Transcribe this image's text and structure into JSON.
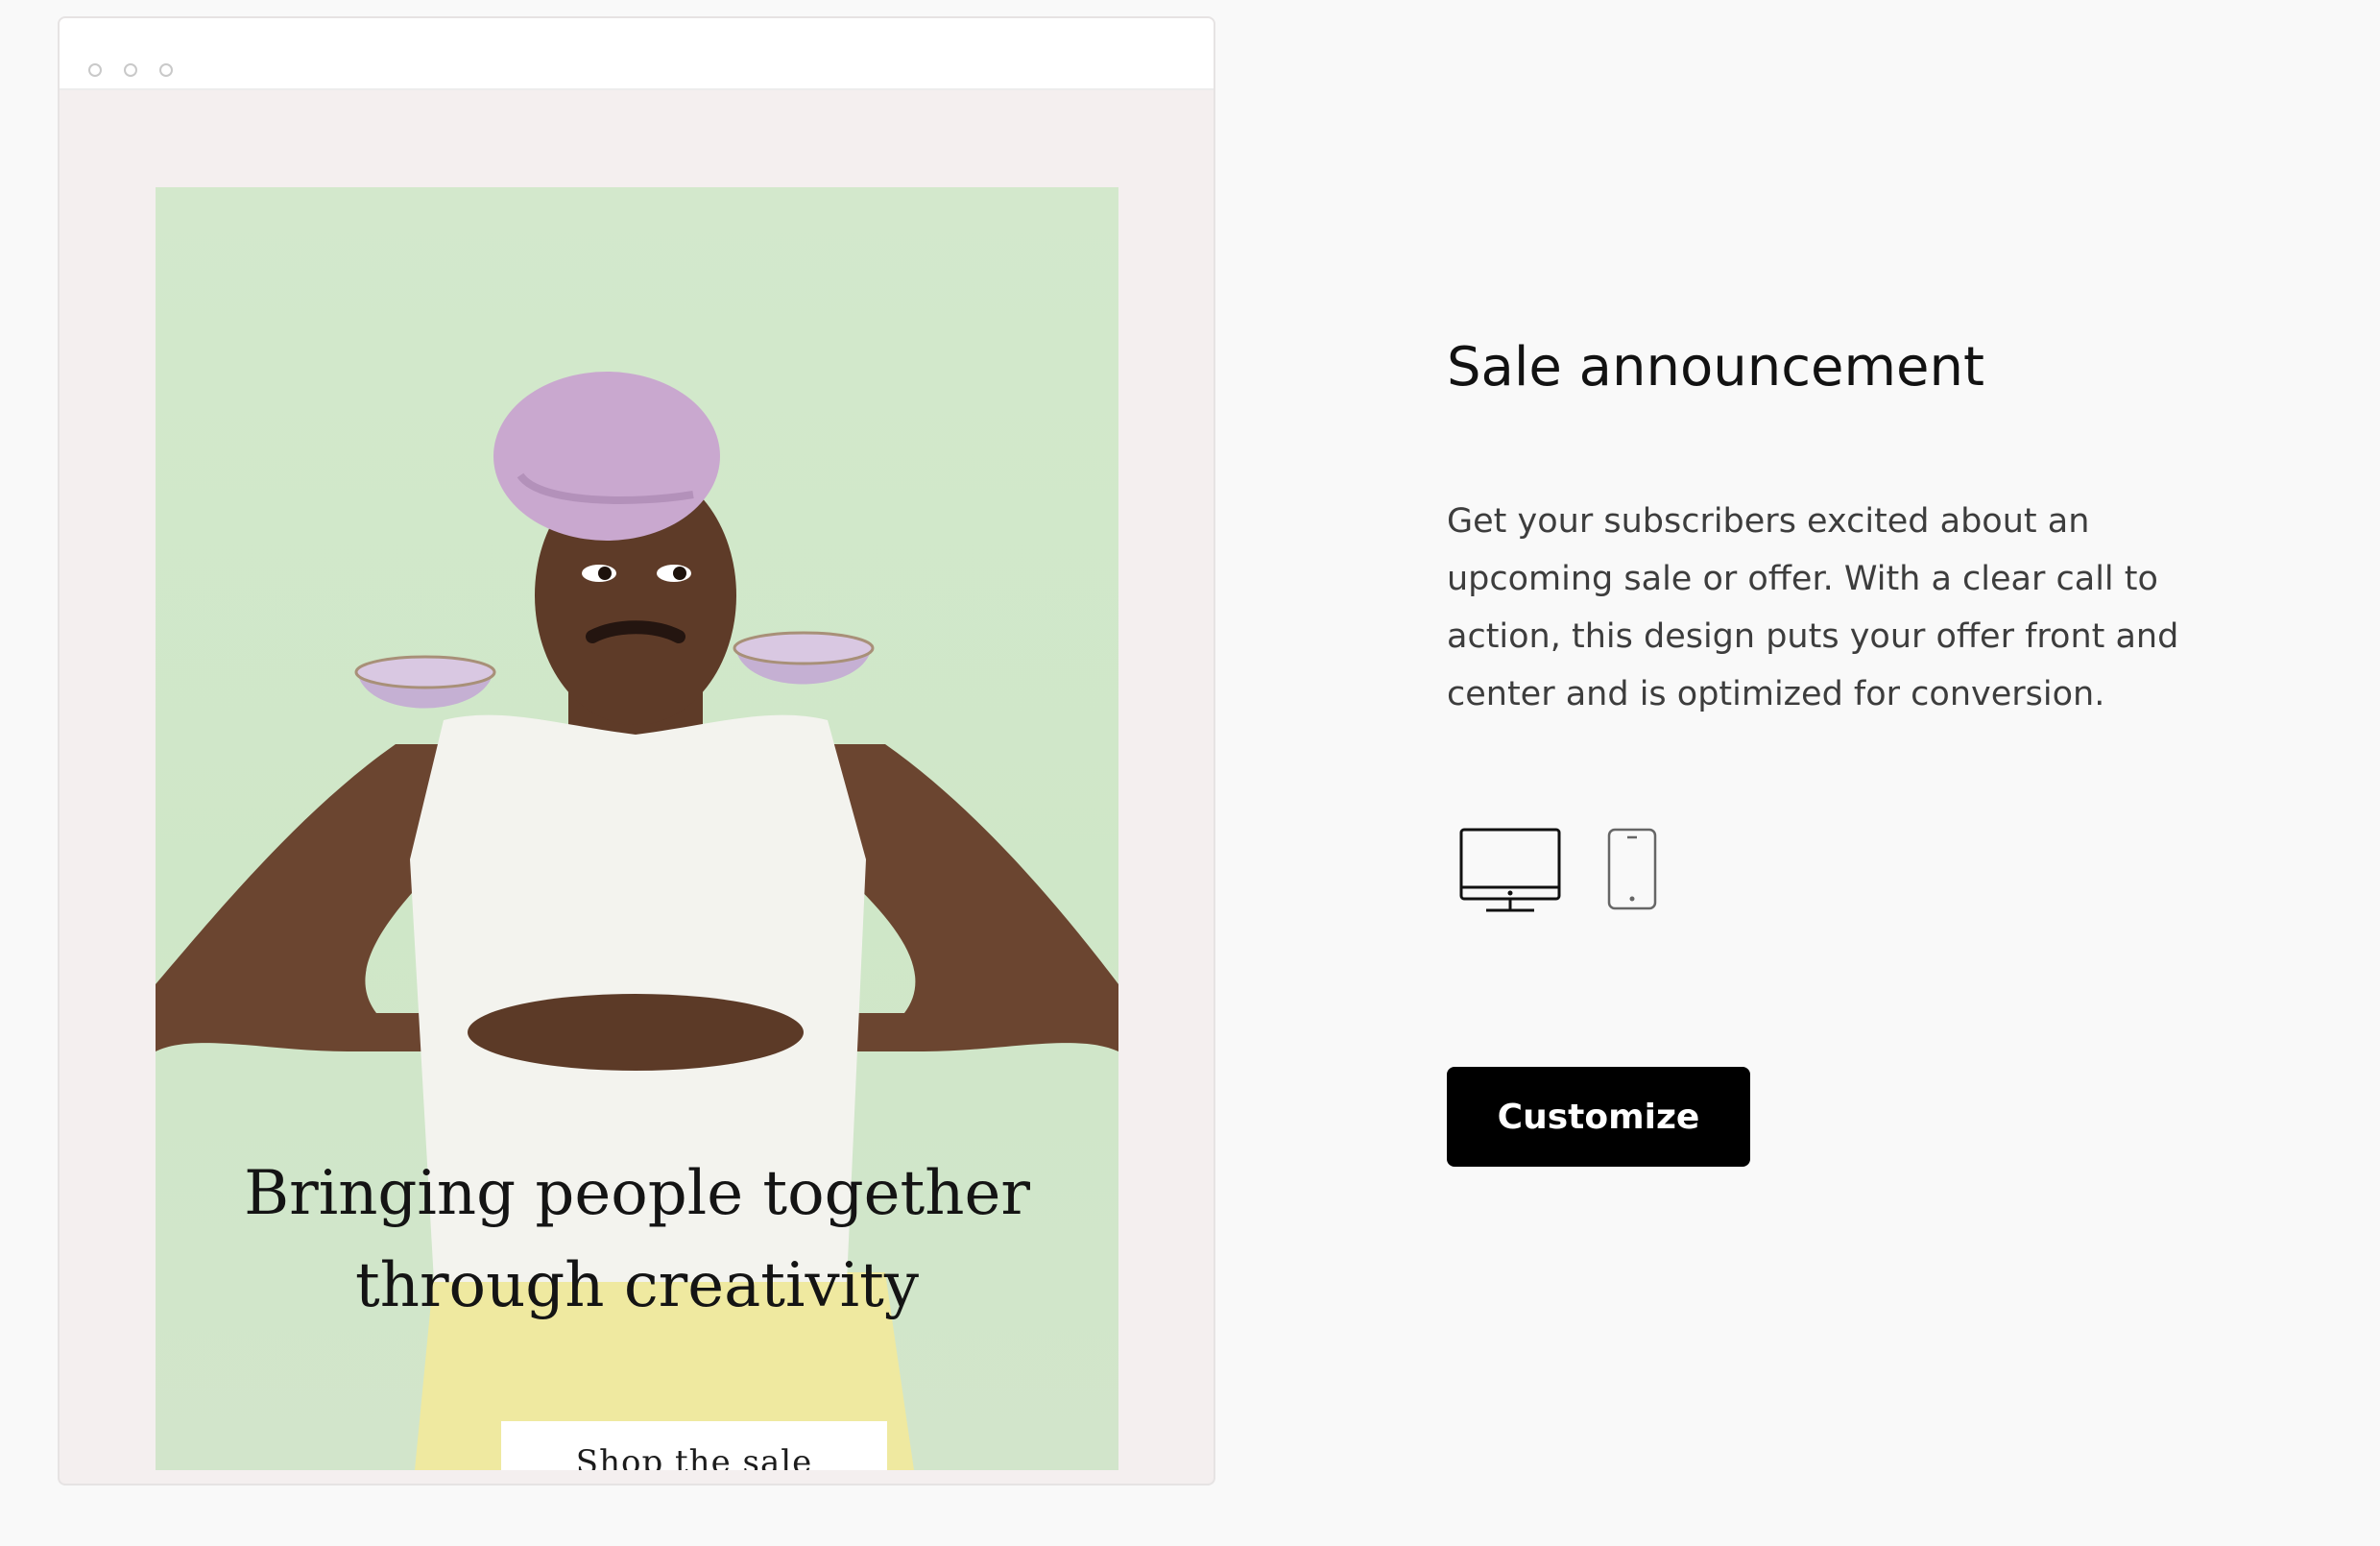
{
  "preview": {
    "window_controls": [
      "circle-dot",
      "circle-dot",
      "circle-dot"
    ],
    "email": {
      "headline_line1": "Bringing people together",
      "headline_line2": "through creativity",
      "cta_label": "Shop the sale",
      "background_color": "#d3e8cc",
      "image_subject": "person-with-bowls-on-shoulders"
    }
  },
  "template": {
    "title": "Sale announcement",
    "description": "Get your subscribers excited about an upcoming sale or offer. With a clear call to action, this design puts your offer front and center and is optimized for conversion.",
    "device_toggle": [
      {
        "icon": "desktop-icon",
        "selected": true
      },
      {
        "icon": "mobile-icon",
        "selected": false
      }
    ],
    "customize_label": "Customize"
  },
  "colors": {
    "page_background": "#f9f9f9",
    "frame_background": "#f4efef",
    "primary_button": "#000000",
    "primary_button_text": "#ffffff"
  }
}
